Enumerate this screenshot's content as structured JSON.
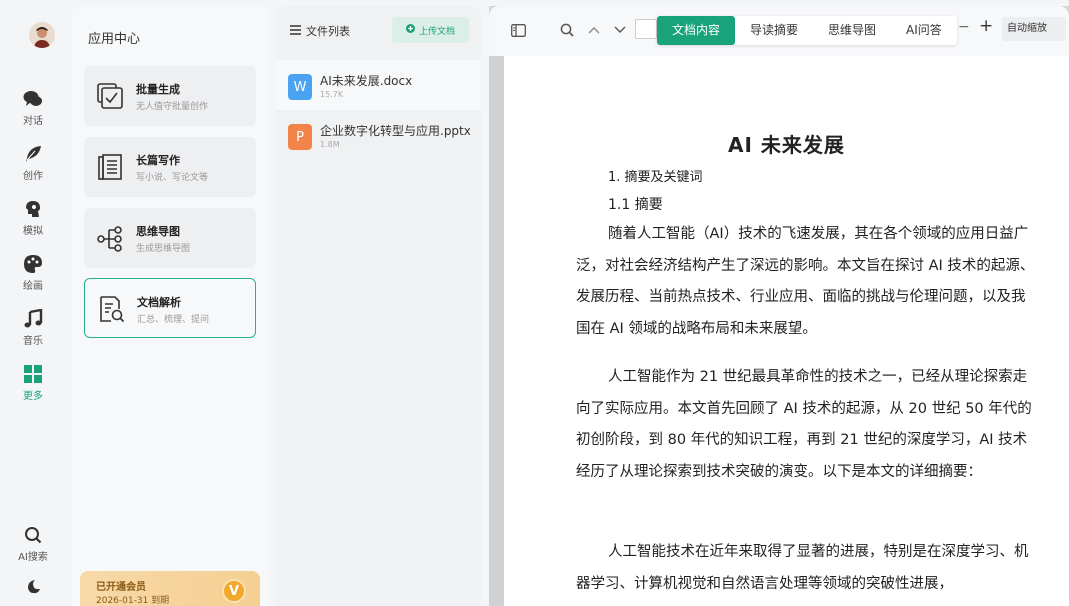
{
  "rail": {
    "items": [
      {
        "label": "对话",
        "icon": "chat-icon"
      },
      {
        "label": "创作",
        "icon": "feather-icon"
      },
      {
        "label": "模拟",
        "icon": "head-icon"
      },
      {
        "label": "绘画",
        "icon": "palette-icon"
      },
      {
        "label": "音乐",
        "icon": "music-icon"
      },
      {
        "label": "更多",
        "icon": "grid-icon"
      }
    ],
    "bottom": [
      {
        "label": "AI搜索",
        "icon": "search-icon"
      }
    ],
    "active_color": "#1aa37a"
  },
  "appcenter": {
    "title": "应用中心",
    "cards": [
      {
        "title": "批量生成",
        "subtitle": "无人值守批量创作"
      },
      {
        "title": "长篇写作",
        "subtitle": "写小说、写论文等"
      },
      {
        "title": "思维导图",
        "subtitle": "生成思维导图"
      },
      {
        "title": "文档解析",
        "subtitle": "汇总、梳理、提问"
      }
    ],
    "vip": {
      "title": "已开通会员",
      "expiry": "2026-01-31 到期",
      "badge": "V"
    }
  },
  "files": {
    "header": "文件列表",
    "upload_label": "上传文档",
    "items": [
      {
        "name": "AI未来发展.docx",
        "size": "15.7K",
        "type": "W",
        "color": "#4aa3f0"
      },
      {
        "name": "企业数字化转型与应用.pptx",
        "size": "1.8M",
        "type": "P",
        "color": "#f2844a"
      }
    ]
  },
  "viewer": {
    "tabs": [
      "文档内容",
      "导读摘要",
      "思维导图",
      "AI问答"
    ],
    "zoom_label": "自动缩放",
    "zoom_minus": "−",
    "zoom_plus": "+"
  },
  "document": {
    "title": "AI 未来发展",
    "heading1": "1. 摘要及关键词",
    "heading2": "1.1 摘要",
    "paragraphs": [
      "随着人工智能（AI）技术的飞速发展，其在各个领域的应用日益广泛，对社会经济结构产生了深远的影响。本文旨在探讨 AI 技术的起源、发展历程、当前热点技术、行业应用、面临的挑战与伦理问题，以及我国在 AI 领域的战略布局和未来展望。",
      "人工智能作为 21 世纪最具革命性的技术之一，已经从理论探索走向了实际应用。本文首先回顾了 AI 技术的起源，从 20 世纪 50 年代的初创阶段，到 80 年代的知识工程，再到 21 世纪的深度学习，AI 技术经历了从理论探索到技术突破的演变。以下是本文的详细摘要：",
      "人工智能技术在近年来取得了显著的进展，特别是在深度学习、机器学习、计算机视觉和自然语言处理等领域的突破性进展，"
    ]
  }
}
